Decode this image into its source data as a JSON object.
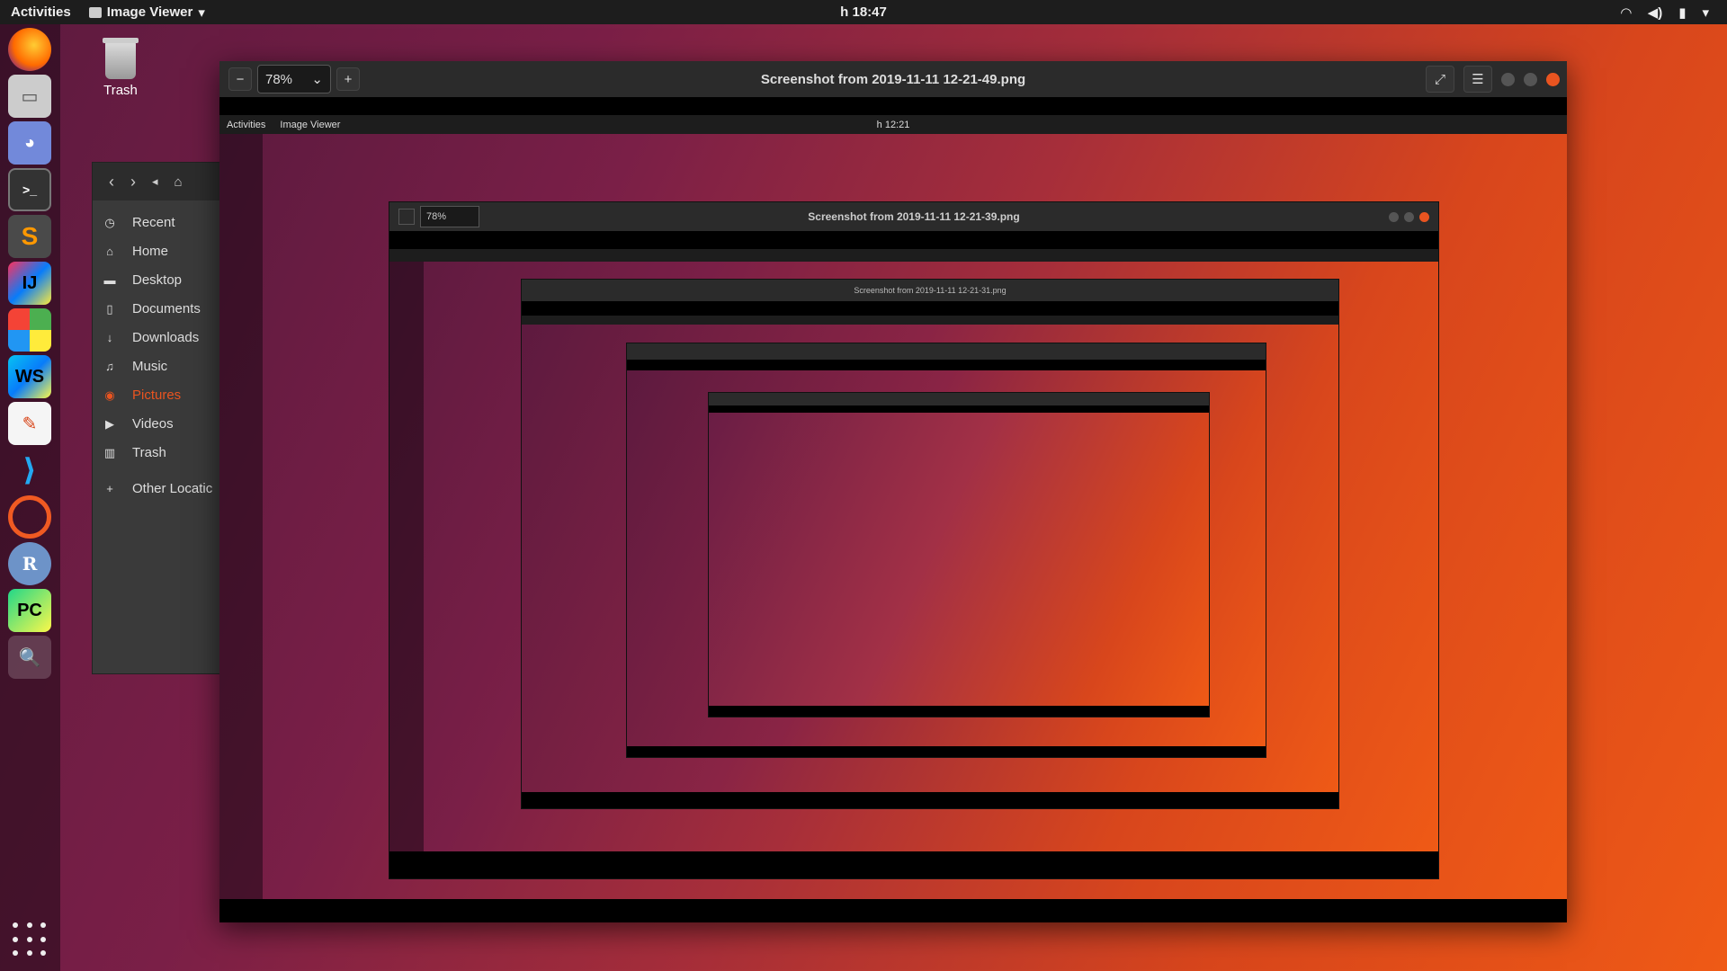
{
  "topbar": {
    "activities": "Activities",
    "app_name": "Image Viewer",
    "clock": "h 18:47"
  },
  "desktop": {
    "trash_label": "Trash"
  },
  "files_sidebar": {
    "items": [
      {
        "label": "Recent",
        "icon": "clock-icon"
      },
      {
        "label": "Home",
        "icon": "home-icon"
      },
      {
        "label": "Desktop",
        "icon": "folder-icon"
      },
      {
        "label": "Documents",
        "icon": "document-icon"
      },
      {
        "label": "Downloads",
        "icon": "download-icon"
      },
      {
        "label": "Music",
        "icon": "music-icon"
      },
      {
        "label": "Pictures",
        "icon": "camera-icon"
      },
      {
        "label": "Videos",
        "icon": "video-icon"
      },
      {
        "label": "Trash",
        "icon": "trash-icon"
      },
      {
        "label": "Other Locatic",
        "icon": "plus-icon"
      }
    ]
  },
  "viewer": {
    "zoom": "78%",
    "title": "Screenshot from 2019-11-11 12-21-49.png"
  },
  "nested1": {
    "zoom": "78%",
    "title": "Screenshot from 2019-11-11 12-21-39.png",
    "clock": "h 12:21"
  },
  "nested2": {
    "title": "Screenshot from 2019-11-11 12-21-31.png"
  },
  "dock": {
    "apps": [
      "firefox",
      "files",
      "discord",
      "terminal",
      "sublime",
      "intellij",
      "windows",
      "webstorm",
      "text-editor",
      "vscode",
      "ubuntu-software",
      "r",
      "pycharm",
      "image-viewer"
    ]
  },
  "colors": {
    "accent": "#e95420",
    "topbar": "#1d1d1d",
    "headerbar": "#2b2b2b"
  }
}
